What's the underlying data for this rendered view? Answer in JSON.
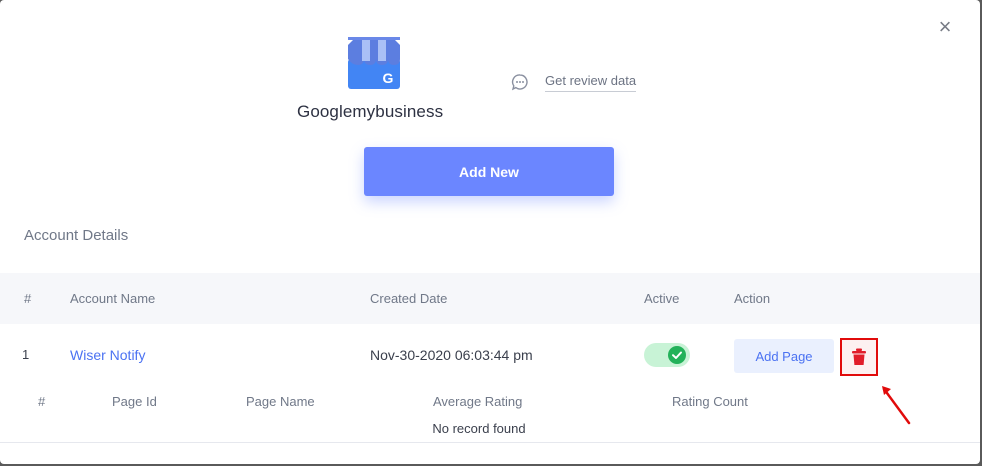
{
  "modal": {
    "close_label": "×",
    "brand": {
      "name": "Googlemybusiness",
      "logo_icon": "google-my-business-icon",
      "logo_letter": "G"
    },
    "review_link": {
      "icon": "chat-bubble-icon",
      "label": "Get review data"
    },
    "add_new_label": "Add New",
    "section_title": "Account Details"
  },
  "accounts_table": {
    "columns": [
      "#",
      "Account Name",
      "Created Date",
      "Active",
      "Action"
    ],
    "rows": [
      {
        "index": "1",
        "account_name": "Wiser Notify",
        "created_date": "Nov-30-2020 06:03:44 pm",
        "active": true,
        "add_page_label": "Add Page",
        "delete_icon": "trash-icon"
      }
    ]
  },
  "pages_table": {
    "columns": [
      "#",
      "Page Id",
      "Page Name",
      "Average Rating",
      "Rating Count"
    ],
    "empty_text": "No record found"
  },
  "colors": {
    "primary": "#6b86ff",
    "link": "#4b72f2",
    "toggle_on": "#23b25a",
    "highlight": "#e10b0b"
  }
}
